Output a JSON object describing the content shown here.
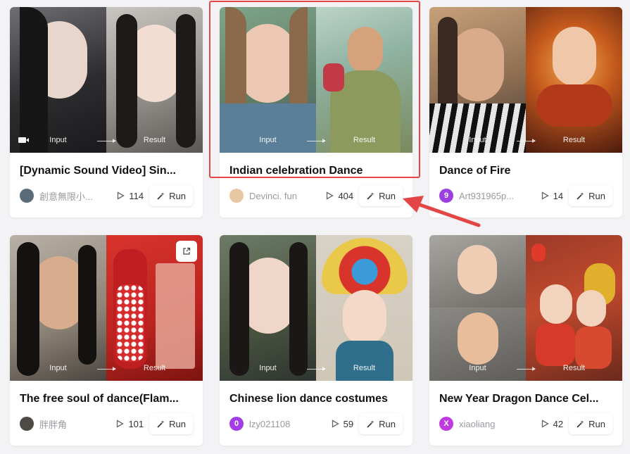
{
  "labels": {
    "input": "Input",
    "result": "Result",
    "run": "Run"
  },
  "accent": "#e44545",
  "cards": [
    {
      "title": "[Dynamic Sound Video] Sin...",
      "author": "創意無限小...",
      "avatar_letter": "",
      "avatar_color": "#5a6b7a",
      "plays": "114",
      "video": true
    },
    {
      "title": "Indian celebration Dance",
      "author": "Devinci. fun",
      "avatar_letter": "",
      "avatar_color": "#e8c7a3",
      "plays": "404",
      "highlighted": true
    },
    {
      "title": "Dance of Fire",
      "author": "Art931965p...",
      "avatar_letter": "9",
      "avatar_color": "#9b3fe0",
      "plays": "14"
    },
    {
      "title": "The free soul of dance(Flam...",
      "author": "胖胖角",
      "avatar_letter": "",
      "avatar_color": "#4e4a45",
      "plays": "101",
      "share": true
    },
    {
      "title": "Chinese lion dance costumes",
      "author": "lzy021108",
      "avatar_letter": "0",
      "avatar_color": "#a23de8",
      "plays": "59"
    },
    {
      "title": "New Year Dragon Dance Cel...",
      "author": "xiaoliang",
      "avatar_letter": "X",
      "avatar_color": "#c03ae0",
      "plays": "42"
    }
  ]
}
